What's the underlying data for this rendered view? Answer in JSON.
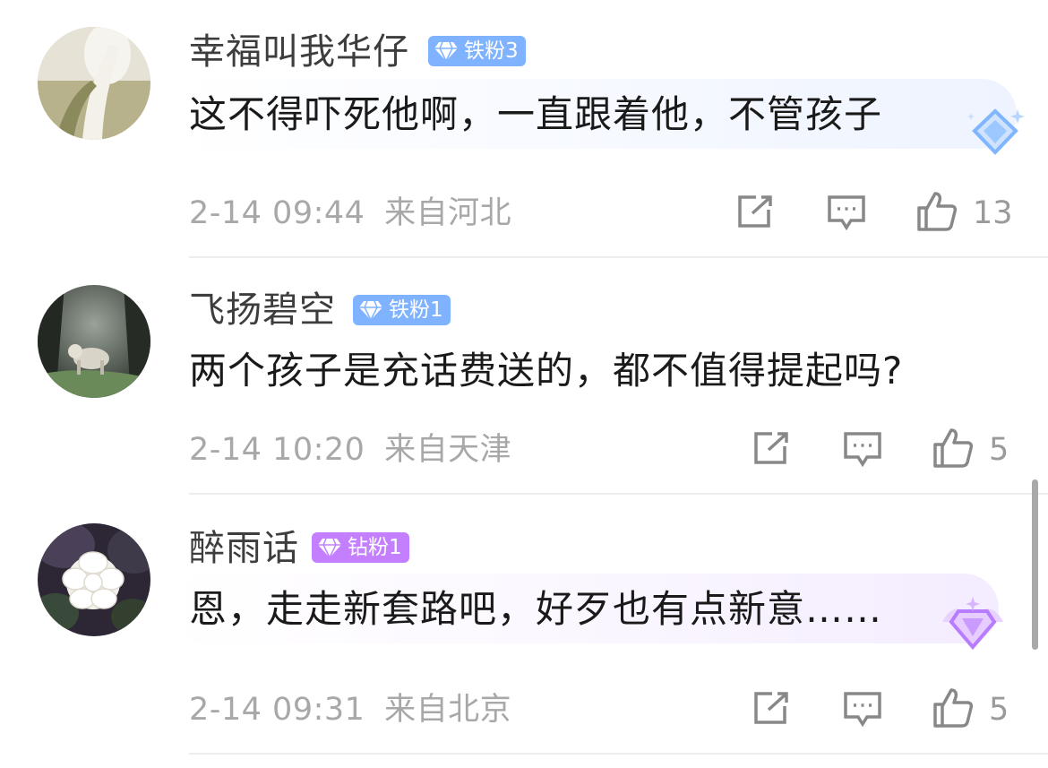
{
  "comments": [
    {
      "username": "幸福叫我华仔",
      "badge": "铁粉3",
      "badge_color": "#7fb3ff",
      "text": "这不得吓死他啊，一直跟着他，不管孩子",
      "time": "2-14 09:44",
      "location": "来自河北",
      "likes": "13",
      "avatar_icon": "calla-lily-photo"
    },
    {
      "username": "飞扬碧空",
      "badge": "铁粉1",
      "badge_color": "#7fb3ff",
      "text": "两个孩子是充话费送的，都不值得提起吗?",
      "time": "2-14 10:20",
      "location": "来自天津",
      "likes": "5",
      "avatar_icon": "forest-animal-photo"
    },
    {
      "username": "醉雨话",
      "badge": "钻粉1",
      "badge_color": "#c47fff",
      "text": "恩，走走新套路吧，好歹也有点新意……",
      "time": "2-14 09:31",
      "location": "来自北京",
      "likes": "5",
      "avatar_icon": "white-camellia-photo"
    }
  ]
}
